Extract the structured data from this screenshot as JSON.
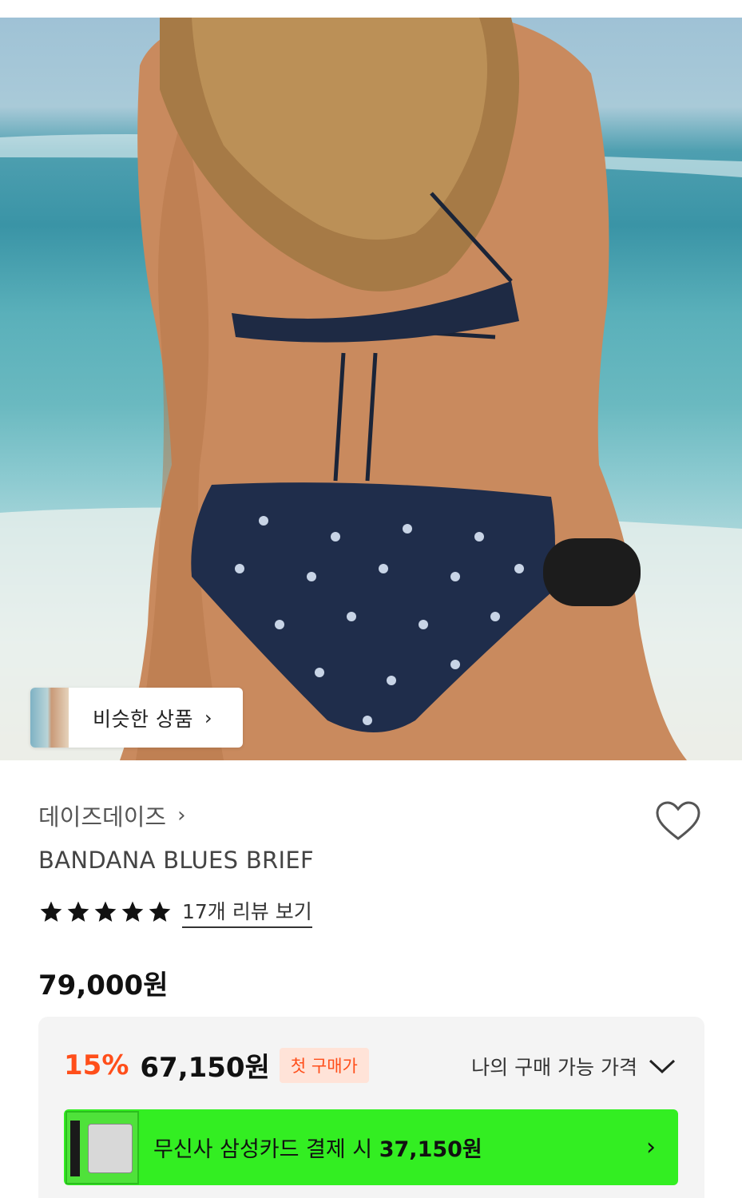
{
  "similar": {
    "label": "비슷한 상품"
  },
  "product": {
    "brand": "데이즈데이즈",
    "name": "BANDANA BLUES BRIEF",
    "rating_stars": 5,
    "review_link": "17개 리뷰 보기",
    "price": "79,000원"
  },
  "discount": {
    "percent": "15%",
    "price": "67,150원",
    "badge": "첫 구매가",
    "my_price_label": "나의 구매 가능 가격"
  },
  "card_offer": {
    "text_prefix": "무신사 삼성카드 결제 시 ",
    "amount": "37,150원"
  },
  "colors": {
    "discount": "#ff4e1a",
    "card_bar": "#33ee22",
    "panel_bg": "#f4f4f4"
  },
  "icons": {
    "similar_chevron": "chevron-right-icon",
    "brand_chevron": "chevron-right-icon",
    "wishlist": "heart-icon",
    "rating": "star-icon",
    "expand": "chevron-down-icon",
    "card_chevron": "chevron-right-icon"
  }
}
